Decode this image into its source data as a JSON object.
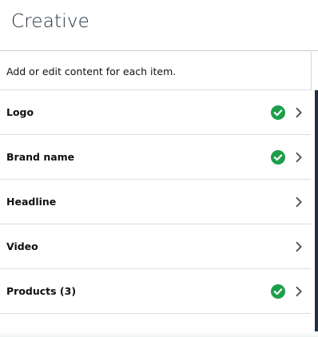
{
  "panel": {
    "title": "Creative",
    "intro": "Add or edit content for each item."
  },
  "colors": {
    "check_green": "#1e9e4a",
    "chevron_gray": "#545b64"
  },
  "items": [
    {
      "label": "Logo",
      "complete": true,
      "icon": "check-circle-icon"
    },
    {
      "label": "Brand name",
      "complete": true,
      "icon": "check-circle-icon"
    },
    {
      "label": "Headline",
      "complete": false
    },
    {
      "label": "Video",
      "complete": false
    },
    {
      "label": "Products (3)",
      "complete": true,
      "icon": "check-circle-icon"
    }
  ]
}
